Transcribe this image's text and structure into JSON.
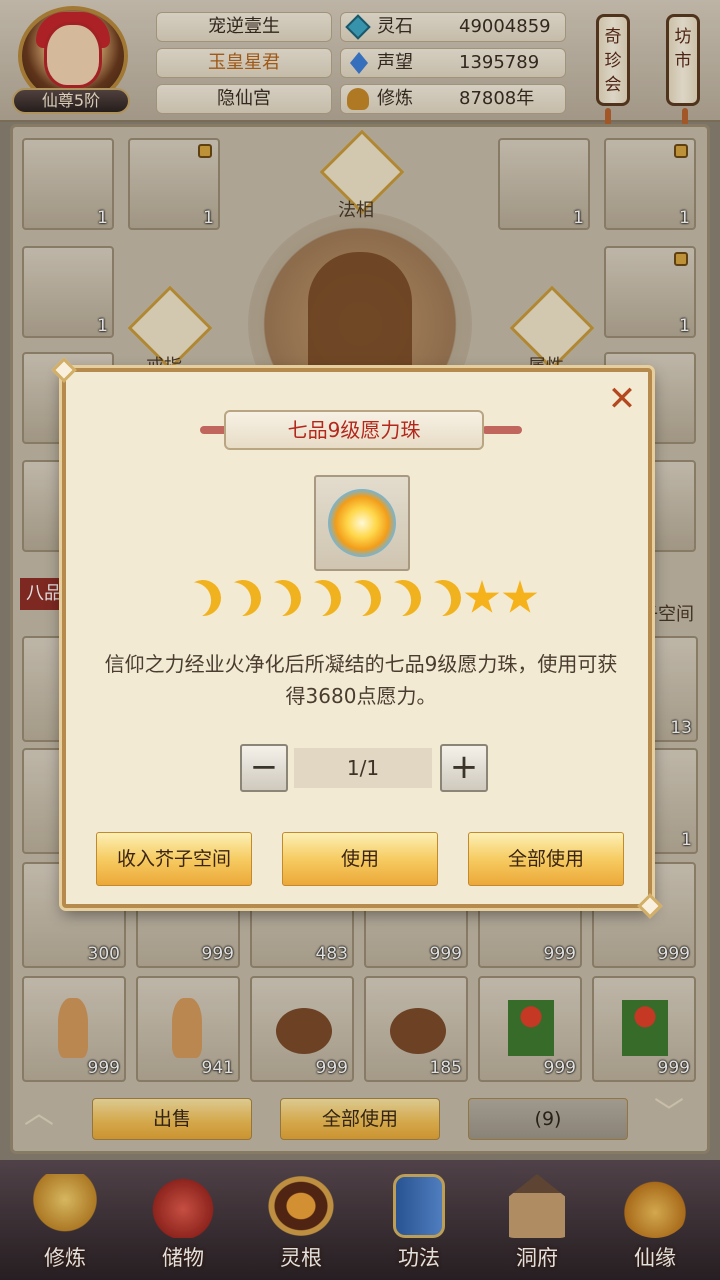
{
  "header": {
    "rank_badge": "仙尊5阶",
    "names": [
      "宠逆壹生",
      "玉皇星君",
      "隐仙宫"
    ],
    "resources": [
      {
        "label": "灵石",
        "value": "49004859",
        "icon": "spirit-stone-icon",
        "color": "#3fa7c4"
      },
      {
        "label": "声望",
        "value": "1395789",
        "icon": "reputation-crystal-icon",
        "color": "#3e7fd6"
      },
      {
        "label": "修炼",
        "value": "87808年",
        "icon": "cultivation-icon",
        "color": "#c88a2a"
      }
    ],
    "scroll_buttons": [
      {
        "label": "奇珍会"
      },
      {
        "label": "坊市"
      }
    ]
  },
  "equip": {
    "top_label": "法相",
    "left_label": "戒指",
    "right_label": "属性",
    "left_slots": [
      {
        "qty": "1",
        "locked": false
      },
      {
        "qty": "1",
        "locked": true
      },
      {
        "qty": "1",
        "locked": false
      }
    ],
    "right_slots": [
      {
        "qty": "1",
        "locked": false
      },
      {
        "qty": "1",
        "locked": true
      },
      {
        "qty": "1",
        "locked": true
      }
    ]
  },
  "bag": {
    "left_tab": "八品",
    "right_tab": "芥子空间",
    "side_qtys": [
      "13",
      "1"
    ],
    "row1": [
      "300",
      "999",
      "483",
      "999",
      "999",
      "999"
    ],
    "row2": [
      "999",
      "941",
      "999",
      "185",
      "999",
      "999"
    ],
    "buttons": {
      "sell": "出售",
      "use_all": "全部使用",
      "count": "(9)"
    }
  },
  "nav": [
    "修炼",
    "储物",
    "灵根",
    "功法",
    "洞府",
    "仙缘"
  ],
  "modal": {
    "title": "七品9级愿力珠",
    "moons": 7,
    "stars": 2,
    "description": "信仰之力经业火净化后所凝结的七品9级愿力珠，使用可获得3680点愿力。",
    "quantity": "1/1",
    "minus": "−",
    "plus": "+",
    "close": "✕",
    "buttons": {
      "store": "收入芥子空间",
      "use": "使用",
      "use_all": "全部使用"
    }
  }
}
